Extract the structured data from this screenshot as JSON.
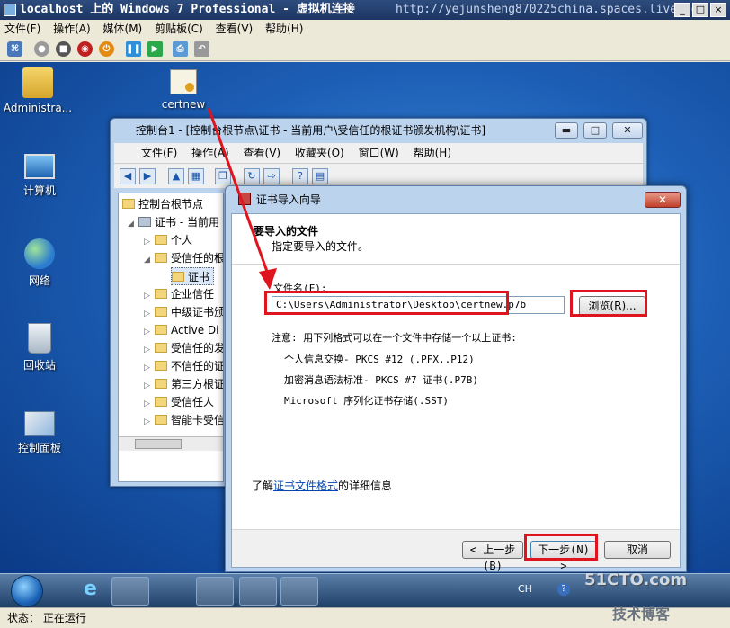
{
  "vm": {
    "title": "localhost 上的 Windows 7 Professional - 虚拟机连接",
    "watermark": "http://yejunsheng870225china.spaces.live.com",
    "menu": [
      "文件(F)",
      "操作(A)",
      "媒体(M)",
      "剪贴板(C)",
      "查看(V)",
      "帮助(H)"
    ],
    "status_label": "状态：",
    "status_value": "正在运行"
  },
  "desktop": {
    "icons": [
      {
        "label": "Administra...",
        "icon": "user-folder-icon"
      },
      {
        "label": "certnew",
        "icon": "certificate-icon"
      },
      {
        "label": "计算机",
        "icon": "computer-icon"
      },
      {
        "label": "网络",
        "icon": "network-icon"
      },
      {
        "label": "回收站",
        "icon": "recycle-bin-icon"
      },
      {
        "label": "控制面板",
        "icon": "control-panel-icon"
      }
    ]
  },
  "mmc": {
    "title": "控制台1 - [控制台根节点\\证书 - 当前用户\\受信任的根证书颁发机构\\证书]",
    "menu": [
      "文件(F)",
      "操作(A)",
      "查看(V)",
      "收藏夹(O)",
      "窗口(W)",
      "帮助(H)"
    ],
    "tree": [
      {
        "label": "控制台根节点",
        "indent": 0,
        "arrow": ""
      },
      {
        "label": "证书 - 当前用",
        "indent": 1,
        "arrow": "◢"
      },
      {
        "label": "个人",
        "indent": 2,
        "arrow": "▷"
      },
      {
        "label": "受信任的根",
        "indent": 2,
        "arrow": "◢"
      },
      {
        "label": "证书",
        "indent": 3,
        "arrow": ""
      },
      {
        "label": "企业信任",
        "indent": 2,
        "arrow": "▷"
      },
      {
        "label": "中级证书颁",
        "indent": 2,
        "arrow": "▷"
      },
      {
        "label": "Active Di",
        "indent": 2,
        "arrow": "▷"
      },
      {
        "label": "受信任的发",
        "indent": 2,
        "arrow": "▷"
      },
      {
        "label": "不信任的证",
        "indent": 2,
        "arrow": "▷"
      },
      {
        "label": "第三方根证",
        "indent": 2,
        "arrow": "▷"
      },
      {
        "label": "受信任人",
        "indent": 2,
        "arrow": "▷"
      },
      {
        "label": "智能卡受信",
        "indent": 2,
        "arrow": "▷"
      }
    ]
  },
  "wizard": {
    "title": "证书导入向导",
    "heading": "要导入的文件",
    "subheading": "指定要导入的文件。",
    "file_label": "文件名(F):",
    "file_value": "C:\\Users\\Administrator\\Desktop\\certnew.p7b",
    "browse_label": "浏览(R)...",
    "note": "注意: 用下列格式可以在一个文件中存储一个以上证书:",
    "formats": [
      "个人信息交换- PKCS #12 (.PFX,.P12)",
      "加密消息语法标准- PKCS #7 证书(.P7B)",
      "Microsoft 序列化证书存储(.SST)"
    ],
    "learn_prefix": "了解",
    "learn_link": "证书文件格式",
    "learn_suffix": "的详细信息",
    "back_label": "< 上一步(B)",
    "next_label": "下一步(N) >",
    "cancel_label": "取消"
  },
  "tray": {
    "lang": "CH"
  },
  "branding": {
    "site": "51CTO.com",
    "blog": "技术博客"
  },
  "colors": {
    "highlight": "#e0141f",
    "link": "#0645ad"
  }
}
